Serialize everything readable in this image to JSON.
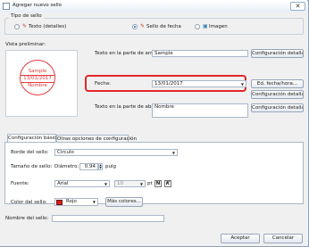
{
  "window": {
    "title": "Agregar nuevo sello",
    "close_glyph": "✕"
  },
  "stamp_type": {
    "legend": "Tipo de sello",
    "options": [
      {
        "label": "Texto (detalles)",
        "icon": "text-stamp-icon",
        "selected": false
      },
      {
        "label": "Sello de fecha",
        "icon": "date-stamp-icon",
        "selected": true
      },
      {
        "label": "Imagen",
        "icon": "image-stamp-icon",
        "selected": false
      }
    ]
  },
  "preview": {
    "label": "Vista preliminar:",
    "top_text": "Sample",
    "date_text": "13/01/2017",
    "bottom_text": "Nombre",
    "color": "#e23c3c"
  },
  "texts": {
    "top_label": "Texto en la parte de arriba:",
    "top_value": "Sample",
    "top_button": "Configuración detallada...",
    "date_label": "Fecha:",
    "date_value": "13/01/2017",
    "date_format_button": "Ed. fecha/hora...",
    "date_button": "Configuración detallada...",
    "bottom_label": "Texto en la parte de abajo:",
    "bottom_value": "Nombre",
    "bottom_button": "Configuración detallada..."
  },
  "tabs": [
    {
      "label": "Configuración básica",
      "active": true
    },
    {
      "label": "Otras opciones de configuración",
      "active": false
    }
  ],
  "basic": {
    "border_label": "Borde del sello:",
    "border_value": "Círculo",
    "size_label": "Tamaño de sello:",
    "diameter_label": "Diámetro:",
    "diameter_value": "0.94",
    "diameter_unit": "pulg",
    "font_label": "Fuente:",
    "font_value": "Arial",
    "font_size_value": "10",
    "font_size_unit": "pt",
    "bold_glyph": "N",
    "italic_glyph": "K",
    "color_label": "Color del sello:",
    "color_value": "Rojo",
    "color_hex": "#d42020",
    "more_colors_button": "Más colores..."
  },
  "name": {
    "label": "Nombre del sello:",
    "value": ""
  },
  "footer": {
    "accept": "Aceptar",
    "cancel": "Cancelar"
  },
  "colors": {
    "highlight": "#e3262a",
    "accent": "#2e68c0"
  }
}
